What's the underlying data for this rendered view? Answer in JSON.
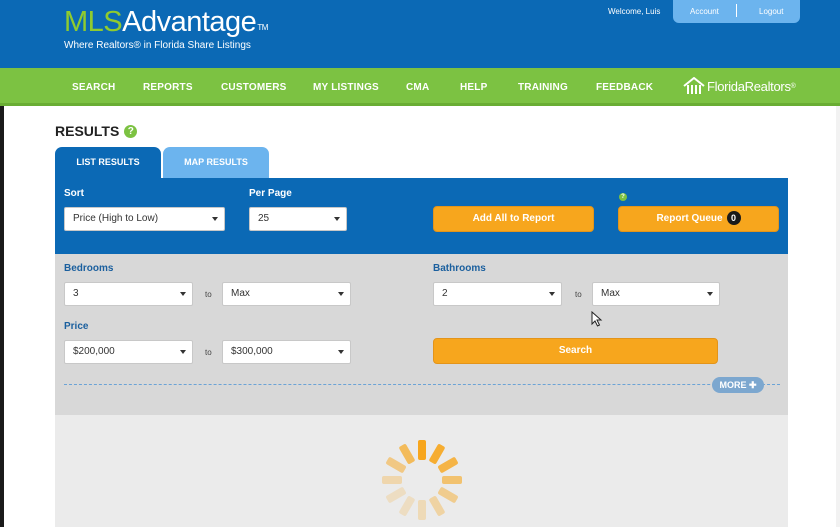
{
  "header": {
    "logo_mls": "MLS",
    "logo_advantage": "Advantage",
    "logo_tm": "TM",
    "tagline": "Where Realtors® in Florida Share Listings",
    "welcome": "Welcome, Luis",
    "account": "Account",
    "logout": "Logout"
  },
  "nav": {
    "items": [
      "SEARCH",
      "REPORTS",
      "CUSTOMERS",
      "MY LISTINGS",
      "CMA",
      "HELP",
      "TRAINING",
      "FEEDBACK"
    ],
    "brand": "FloridaRealtors",
    "brand_mark": "®"
  },
  "page": {
    "title": "RESULTS",
    "help": "?",
    "tabs": [
      "LIST RESULTS",
      "MAP RESULTS"
    ]
  },
  "sort": {
    "sort_label": "Sort",
    "sort_value": "Price (High to Low)",
    "perpage_label": "Per Page",
    "perpage_value": "25",
    "add_all_label": "Add All to Report",
    "report_queue_label": "Report Queue",
    "report_queue_count": "0"
  },
  "filters": {
    "bedrooms_label": "Bedrooms",
    "bedrooms_min": "3",
    "bedrooms_max": "Max",
    "bathrooms_label": "Bathrooms",
    "bathrooms_min": "2",
    "bathrooms_max": "Max",
    "price_label": "Price",
    "price_min": "$200,000",
    "price_max": "$300,000",
    "to": "to",
    "search_label": "Search",
    "more_label": "MORE"
  },
  "colors": {
    "header_blue": "#0b69b5",
    "nav_green": "#7cc242",
    "tab_light_blue": "#6cb4ee",
    "button_orange": "#f7a61d",
    "filter_gray": "#d8d8d8"
  }
}
